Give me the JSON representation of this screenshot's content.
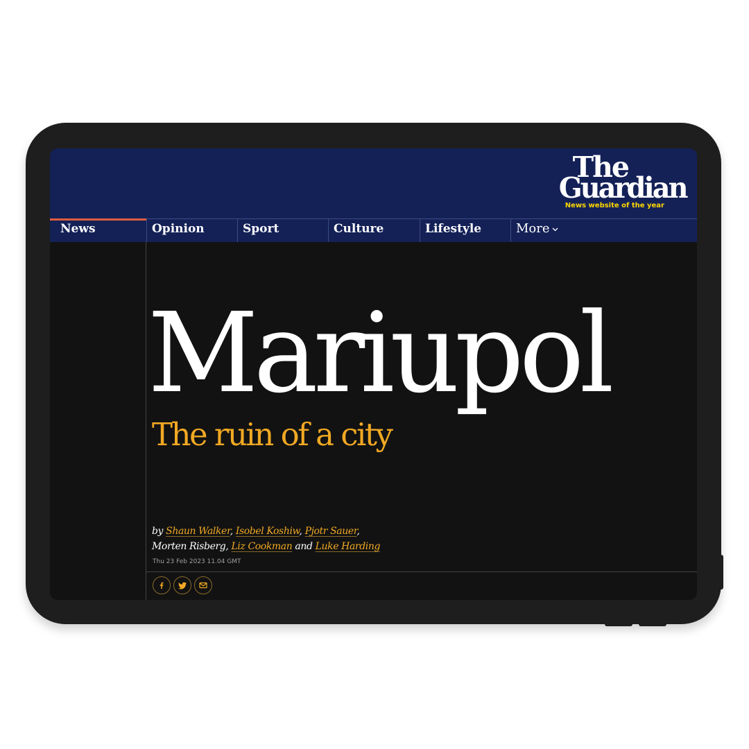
{
  "masthead": {
    "logo_line1": "The",
    "logo_line2": "Guardian",
    "tagline": "News website of the year",
    "background": "#142157"
  },
  "nav": {
    "items": [
      {
        "label": "News",
        "active": true
      },
      {
        "label": "Opinion"
      },
      {
        "label": "Sport"
      },
      {
        "label": "Culture"
      },
      {
        "label": "Lifestyle"
      }
    ],
    "more_label": "More",
    "more_icon": "chevron-down-icon",
    "active_color": "#e05e3e"
  },
  "article": {
    "headline": "Mariupol",
    "standfirst": "The ruin of a city",
    "byline": {
      "prefix": "by",
      "authors": [
        "Shaun Walker",
        "Isobel Koshiw",
        "Pjotr Sauer",
        "Morten Risberg",
        "Liz Cookman",
        "Luke Harding"
      ],
      "conjunction": "and"
    },
    "date": "Thu 23 Feb 2023 11.04 GMT",
    "accent": "#f1a923"
  },
  "share": {
    "icons": [
      "facebook-icon",
      "twitter-icon",
      "email-icon"
    ]
  }
}
